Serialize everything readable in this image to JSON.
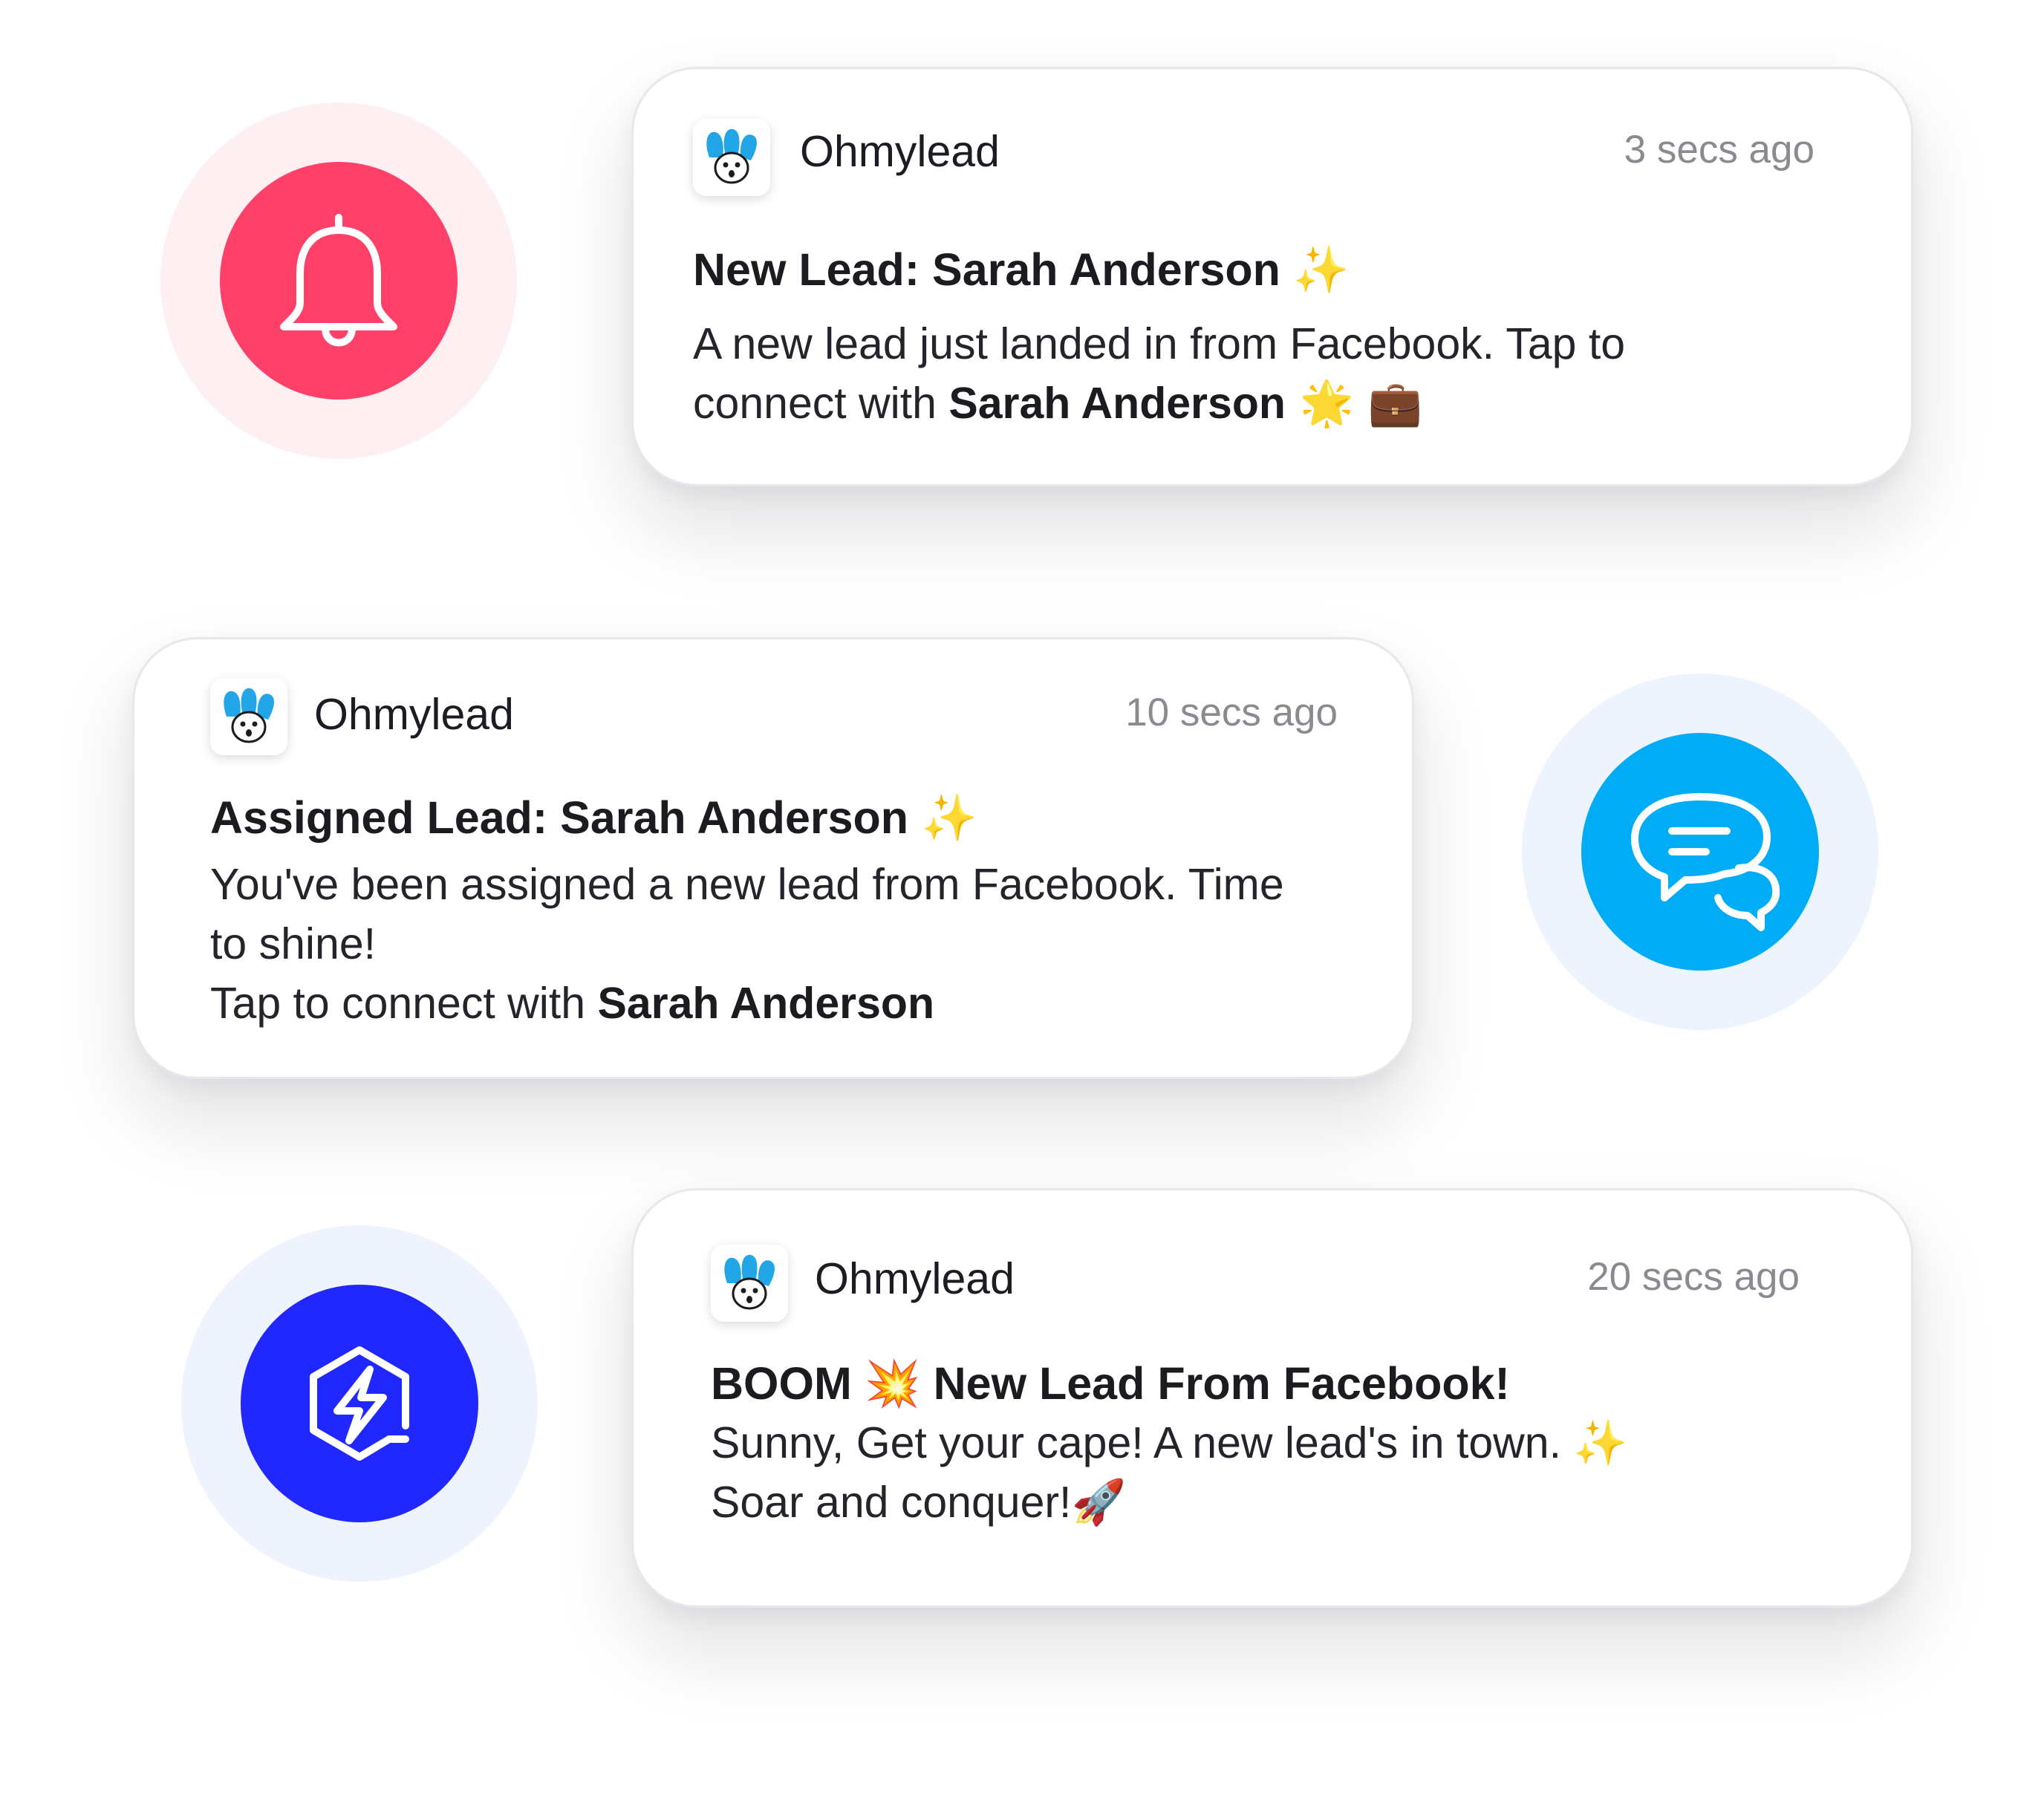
{
  "colors": {
    "bell_badge": "#ff416a",
    "chat_badge": "#00acf5",
    "bolt_badge": "#2128ff"
  },
  "icons": {
    "bell": "bell-icon",
    "chat": "chat-bubbles-icon",
    "bolt": "lightning-hexagon-icon",
    "app": "ohmylead-bunny-logo"
  },
  "notifications": [
    {
      "app_name": "Ohmylead",
      "timestamp": "3 secs ago",
      "title_text": "New Lead: Sarah Anderson",
      "title_emoji": "✨",
      "body_line1": "A new lead just landed in from Facebook. Tap to",
      "body_line2_prefix": "connect with ",
      "body_line2_name": "Sarah Anderson",
      "body_line2_emoji": " 🌟 💼"
    },
    {
      "app_name": "Ohmylead",
      "timestamp": "10 secs ago",
      "title_text": "Assigned Lead: Sarah Anderson",
      "title_emoji": "✨",
      "body_line1": "You've been assigned a new lead from Facebook. Time",
      "body_line2": "to shine!",
      "body_line3_prefix": "Tap to connect with ",
      "body_line3_name": "Sarah Anderson"
    },
    {
      "app_name": "Ohmylead",
      "timestamp": "20 secs ago",
      "title_part1": "BOOM",
      "title_emoji": "💥",
      "title_part2": "New Lead From Facebook!",
      "body_line1": "Sunny, Get your cape! A new lead's in town.",
      "body_line1_emoji": "✨",
      "body_line2": "Soar and conquer!",
      "body_line2_emoji": "🚀"
    }
  ]
}
